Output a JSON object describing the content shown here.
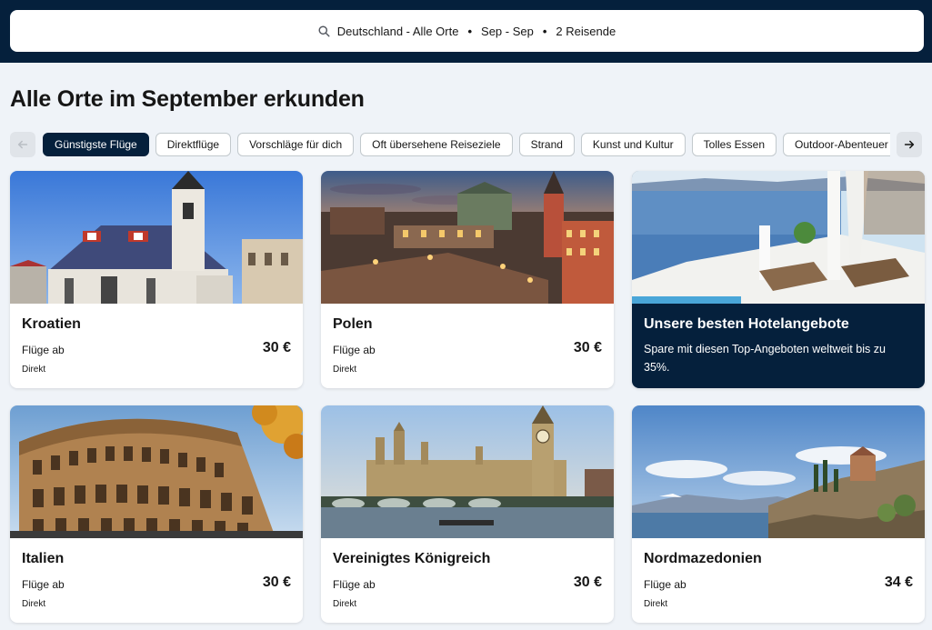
{
  "search": {
    "destination": "Deutschland - Alle Orte",
    "dates": "Sep - Sep",
    "travelers": "2 Reisende",
    "separator": "•"
  },
  "heading": "Alle Orte im September erkunden",
  "categories": [
    {
      "label": "Günstigste Flüge",
      "active": true
    },
    {
      "label": "Direktflüge"
    },
    {
      "label": "Vorschläge für dich"
    },
    {
      "label": "Oft übersehene Reiseziele"
    },
    {
      "label": "Strand"
    },
    {
      "label": "Kunst und Kultur"
    },
    {
      "label": "Tolles Essen"
    },
    {
      "label": "Outdoor-Abenteuer"
    },
    {
      "label": ""
    }
  ],
  "cards": [
    {
      "title": "Kroatien",
      "from_label": "Flüge ab",
      "price": "30 €",
      "direct": "Direkt",
      "image": "zagreb-church-photo"
    },
    {
      "title": "Polen",
      "from_label": "Flüge ab",
      "price": "30 €",
      "direct": "Direkt",
      "image": "warsaw-old-town-photo"
    },
    {
      "title": "Unsere besten Hotelangebote",
      "description": "Spare mit diesen Top-Angeboten weltweit bis zu 35%.",
      "image": "hotel-terrace-sea-photo"
    },
    {
      "title": "Italien",
      "from_label": "Flüge ab",
      "price": "30 €",
      "direct": "Direkt",
      "image": "colosseum-photo"
    },
    {
      "title": "Vereinigtes Königreich",
      "from_label": "Flüge ab",
      "price": "30 €",
      "direct": "Direkt",
      "image": "london-westminster-photo"
    },
    {
      "title": "Nordmazedonien",
      "from_label": "Flüge ab",
      "price": "34 €",
      "direct": "Direkt",
      "image": "ohrid-lake-photo"
    }
  ],
  "icons": {
    "search": "search-icon",
    "prev": "arrow-left-icon",
    "next": "arrow-right-icon"
  },
  "colors": {
    "header_bg": "#05203c",
    "page_bg": "#eff3f8",
    "active_chip": "#05203c"
  }
}
